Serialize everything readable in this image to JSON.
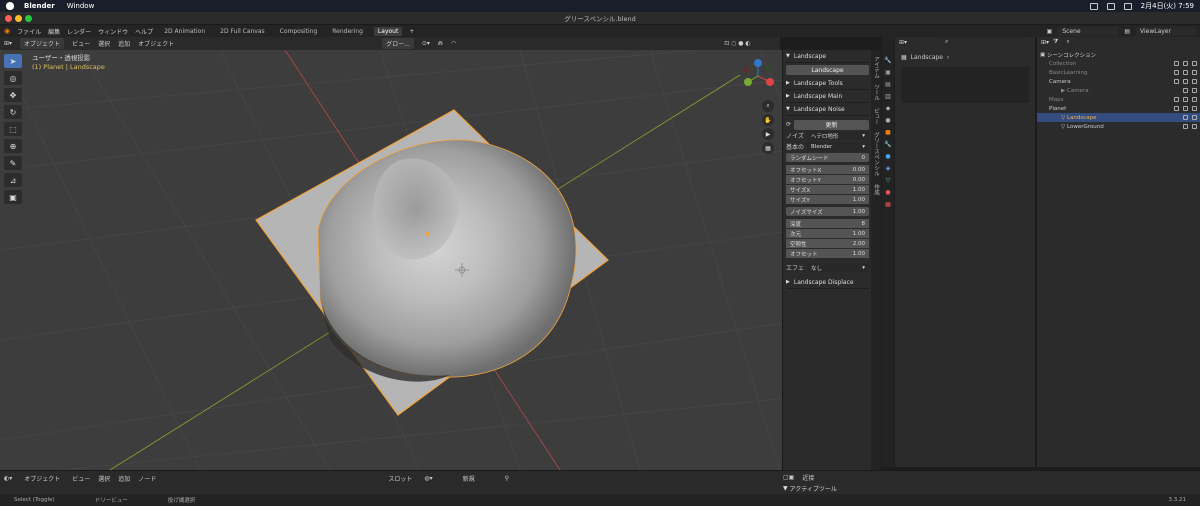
{
  "macbar": {
    "app": "Blender",
    "menu": [
      "Window"
    ],
    "datetime": "2月4日(火) 7:59"
  },
  "window": {
    "title": "グリースペンシル.blend"
  },
  "menubar": {
    "menus": [
      "ファイル",
      "編集",
      "レンダー",
      "ウィンドウ",
      "ヘルプ"
    ],
    "tabs": [
      "2D Animation",
      "2D Full Canvas",
      "Compositing",
      "Rendering",
      "Layout"
    ],
    "active_tab": "Layout",
    "scene": "Scene",
    "view_layer": "ViewLayer"
  },
  "viewport_header": {
    "mode": "オブジェクト",
    "menus": [
      "ビュー",
      "選択",
      "追加",
      "オブジェクト"
    ],
    "transform": "グロー..."
  },
  "viewport_info": {
    "view": "ユーザー・透視投影",
    "object": "(1) Planet | Landscape"
  },
  "npanel": {
    "sections": {
      "landscape": "Landscape",
      "landscape_button": "Landscape",
      "tools": "Landscape Tools",
      "main": "Landscape Main",
      "noise": "Landscape Noise",
      "displace": "Landscape Displace"
    },
    "update_button": "更新",
    "noise_label": "ノイズ",
    "noise_value": "ヘテロ地形",
    "basis_label": "基本の",
    "basis_value": "Blender",
    "random_seed": {
      "label": "ランダムシード",
      "value": "0"
    },
    "offsets": [
      {
        "label": "オフセットX",
        "value": "0.00"
      },
      {
        "label": "オフセットY",
        "value": "0.00"
      },
      {
        "label": "サイズX",
        "value": "1.00"
      },
      {
        "label": "サイズY",
        "value": "1.00"
      }
    ],
    "noise_size": {
      "label": "ノイズサイズ",
      "value": "1.00"
    },
    "params": [
      {
        "label": "深度",
        "value": "8"
      },
      {
        "label": "次元",
        "value": "1.00"
      },
      {
        "label": "空隙性",
        "value": "2.00"
      },
      {
        "label": "オフセット",
        "value": "1.00"
      }
    ],
    "effect_label": "エフェ",
    "effect_value": "なし"
  },
  "vtabs": [
    "アイテム",
    "ツール",
    "ビュー",
    "グリースペンシル",
    "作成"
  ],
  "properties": {
    "title": "Landscape"
  },
  "outliner": {
    "header": "シーンコレクション",
    "rows": [
      {
        "label": "Collection",
        "indent": 1,
        "selected": false
      },
      {
        "label": "BasicLearning",
        "indent": 1,
        "selected": false
      },
      {
        "label": "Camera",
        "indent": 1,
        "selected": false
      },
      {
        "label": "Camera",
        "indent": 2,
        "selected": false
      },
      {
        "label": "Maps",
        "indent": 1,
        "selected": false
      },
      {
        "label": "Planet",
        "indent": 1,
        "selected": false
      },
      {
        "label": "Landscape",
        "indent": 2,
        "selected": true
      },
      {
        "label": "LowerGround",
        "indent": 2,
        "selected": false
      }
    ]
  },
  "bottom": {
    "mode": "オブジェクト",
    "menus": [
      "ビュー",
      "選択",
      "追加",
      "ノード"
    ],
    "slot": "スロット",
    "new_button": "新規",
    "snap": "近接",
    "active_tool": "アクティブツール"
  },
  "statusbar": {
    "select": "Select (Toggle)",
    "dolly": "ドリービュー",
    "lasso": "投げ縄選択",
    "version": "3.3.21"
  }
}
